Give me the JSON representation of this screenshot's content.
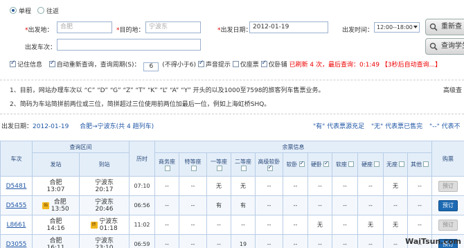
{
  "trip_type": {
    "oneway": "单程",
    "roundtrip": "往返"
  },
  "form": {
    "from_label": "出发地：",
    "from_value": "合肥",
    "to_label": "目的地：",
    "to_value": "宁波东",
    "date_label": "出发日期：",
    "date_value": "2012-01-19",
    "time_label": "出发时间：",
    "time_value": "12:00--18:00",
    "train_no_label": "出发车次：",
    "train_no_value": "",
    "requery_button": "重新查",
    "student_button": "查询学生"
  },
  "options": {
    "remember": "记住信息",
    "auto_requery": "自动重新查询，查询周期(S)：",
    "period": "6",
    "period_hint": "(不得小于6)",
    "sound": "声音提示",
    "only_seat": "仅座票",
    "only_sleeper": "仅卧铺",
    "status": "已刷新 4 次，最后查询：0:1:49",
    "countdown": "【3秒后自动查询...】"
  },
  "notice": {
    "line1": "1、目前，网站办理车次以 “C” “D” “G” “Z” “T” “K” “L” “A” “Y” 开头的以及1000至7598的旅客列车售票业务。",
    "line1_right": "高级查",
    "line2": "2、简码为车站简拼前两位或三位，简拼超过三位使用前两位加最后一位，例如上海虹桥SHQ。"
  },
  "summary": {
    "date_label": "出发日期：",
    "date": "2012-01-19",
    "route": "合肥→宁波东(共 4 趟列车)",
    "legend_yes": "\"有\" 代表票源充足",
    "legend_no": "\"无\" 代表票已售完",
    "legend_dash": "\"--\" 代表不"
  },
  "table": {
    "group_headers": {
      "section": "查询区间",
      "remaining": "余票信息"
    },
    "headers": {
      "train": "车次",
      "from": "发站",
      "to": "到站",
      "duration": "历时",
      "business": "商务座",
      "special": "特等座",
      "first": "一等座",
      "second": "二等座",
      "adv_soft_sleeper": "高级软卧",
      "soft_sleeper": "软卧",
      "hard_sleeper": "硬卧",
      "soft_seat": "软座",
      "hard_seat": "硬座",
      "no_seat": "无座",
      "other": "其他",
      "book": "购票"
    },
    "rows": [
      {
        "train": "D5481",
        "from_st": "合肥",
        "from_t": "13:07",
        "to_st": "宁波东",
        "to_t": "20:17",
        "dur": "07:10",
        "business": "--",
        "special": "--",
        "first": "无",
        "second": "无",
        "adv_soft_sleeper": "--",
        "soft_sleeper": "--",
        "hard_sleeper": "--",
        "soft_seat": "--",
        "hard_seat": "--",
        "no_seat": "无",
        "other": "--",
        "book": "预订"
      },
      {
        "train": "D5455",
        "from_st": "合肥",
        "from_t": "13:50",
        "to_st": "宁波东",
        "to_t": "20:46",
        "dur": "06:56",
        "business": "--",
        "special": "--",
        "first": "有",
        "second": "有",
        "adv_soft_sleeper": "--",
        "soft_sleeper": "--",
        "hard_sleeper": "--",
        "soft_seat": "--",
        "hard_seat": "--",
        "no_seat": "--",
        "other": "--",
        "book": "预订"
      },
      {
        "train": "L8661",
        "from_st": "合肥",
        "from_t": "14:16",
        "to_st": "宁波东",
        "to_t": "01:18",
        "dur": "11:02",
        "business": "--",
        "special": "--",
        "first": "--",
        "second": "--",
        "adv_soft_sleeper": "--",
        "soft_sleeper": "--",
        "hard_sleeper": "无",
        "soft_seat": "--",
        "hard_seat": "无",
        "no_seat": "无",
        "other": "--",
        "book": "预订"
      },
      {
        "train": "D3055",
        "from_st": "合肥",
        "from_t": "16:11",
        "to_st": "宁波东",
        "to_t": "23:10",
        "dur": "06:59",
        "business": "--",
        "special": "--",
        "first": "--",
        "second": "19",
        "adv_soft_sleeper": "--",
        "soft_sleeper": "--",
        "hard_sleeper": "--",
        "soft_seat": "--",
        "hard_seat": "--",
        "no_seat": "--",
        "other": "--",
        "book": "预订"
      }
    ],
    "start_badge": "始",
    "end_badge": "终"
  },
  "watermark": "WaiTsun.com",
  "colors": {
    "link": "#1f56a5",
    "required": "#dd0000",
    "status": "#ee0000",
    "available": "#1a8a1a",
    "book_button": "#1d6ab3",
    "header_bg": "#e4eef9"
  }
}
